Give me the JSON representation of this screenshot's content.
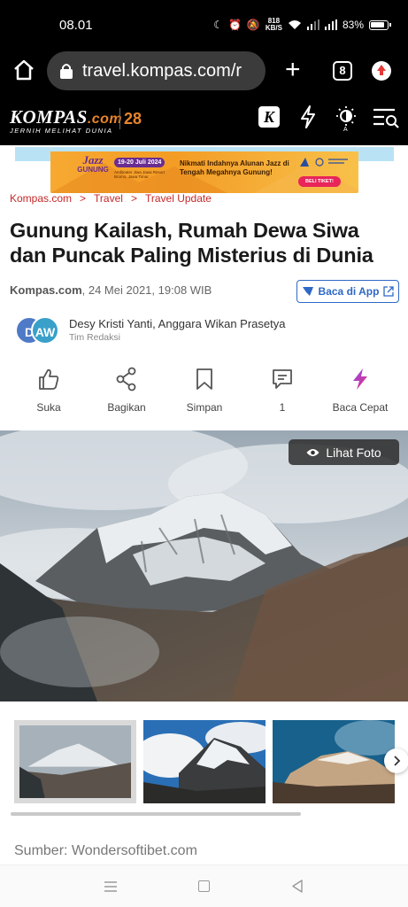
{
  "status_bar": {
    "time": "08.01",
    "net_speed_top": "818",
    "net_speed_unit": "KB/S",
    "battery": "83%"
  },
  "browser": {
    "url": "travel.kompas.com/r",
    "tab_count": "8"
  },
  "site": {
    "logo_main": "KOMPAS",
    "logo_com": ".com",
    "logo_tagline": "JERNIH MELIHAT DUNIA",
    "logo_anniversary": "28",
    "k_button": "K"
  },
  "banner": {
    "logo_line1": "Jazz",
    "logo_line2": "GUNUNG",
    "date": "19-20 Juli 2024",
    "location": "Amfiteater Jiwa Jawa Resort Bromo, Jawa Timur",
    "headline": "Nikmati Indahnya Alunan Jazz di Tengah Megahnya Gunung!",
    "cta": "BELI TIKET!"
  },
  "breadcrumb": [
    "Kompas.com",
    "Travel",
    "Travel Update"
  ],
  "breadcrumb_sep": ">",
  "article": {
    "title": "Gunung Kailash, Rumah Dewa Siwa dan Puncak Paling Misterius di Dunia",
    "source": "Kompas.com",
    "date": ", 24 Mei 2021, 19:08 WIB",
    "app_button": "Baca di App",
    "authors": "Desy Kristi Yanti, Anggara Wikan Prasetya",
    "author_role": "Tim Redaksi",
    "avatar_1": "D",
    "avatar_2": "AW"
  },
  "actions": {
    "like": "Suka",
    "share": "Bagikan",
    "save": "Simpan",
    "comments": "1",
    "quick_read": "Baca Cepat"
  },
  "photo": {
    "view_button": "Lihat Foto",
    "source": "Sumber: Wondersoftibet.com"
  }
}
